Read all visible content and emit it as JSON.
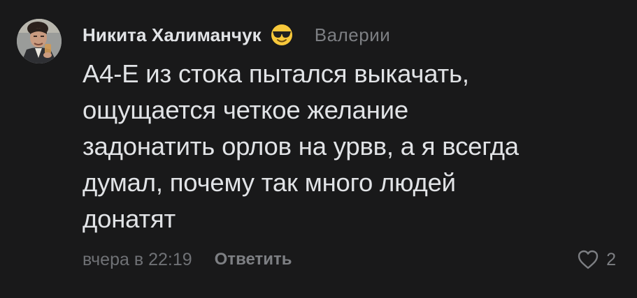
{
  "comment": {
    "author": "Никита Халиманчук",
    "reply_to": "Валерии",
    "text_lines": [
      "А4-Е из стока пытался выкачать,",
      "ощущается четкое желание",
      "задонатить орлов на урвв, а я всегда",
      "думал, почему так много людей",
      "донатят"
    ],
    "timestamp": "вчера в 22:19",
    "reply_label": "Ответить",
    "likes_count": "2",
    "author_emoji": "smiling-face-with-sunglasses-icon",
    "like_icon": "heart-outline-icon"
  },
  "colors": {
    "background": "#19191a",
    "primary_text": "#e1e3e6",
    "secondary_text": "#7d7f83"
  }
}
